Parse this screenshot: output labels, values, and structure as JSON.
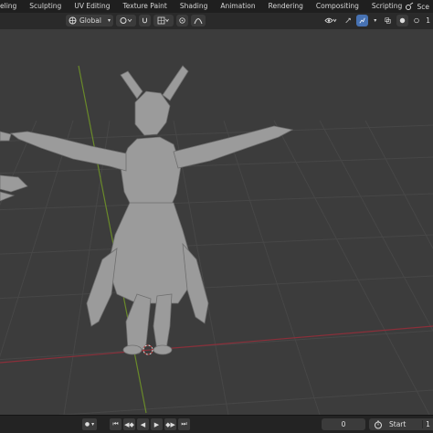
{
  "workspace_tabs": [
    "eling",
    "Sculpting",
    "UV Editing",
    "Texture Paint",
    "Shading",
    "Animation",
    "Rendering",
    "Compositing",
    "Scripting"
  ],
  "add_workspace": "+",
  "scene_label": "Sce",
  "viewport_header": {
    "orientation": "Global",
    "right_counter": "1"
  },
  "timeline": {
    "current_frame": "0",
    "start_label": "Start",
    "start_value": "1"
  },
  "colors": {
    "viewport_bg": "#3c3c3c",
    "grid": "#474747",
    "x_axis": "#8a2f3a",
    "y_axis": "#6a8a2a",
    "model": "#9b9b9b",
    "accent": "#4772b3"
  },
  "icons": {
    "orientation": "global-orientation-icon",
    "snap": "snap-magnet-icon",
    "proportional": "proportional-editing-icon",
    "gizmo": "gizmo-icon",
    "overlay": "overlay-icon",
    "xray": "xray-icon",
    "shading": "viewport-shading-icon",
    "play": "play-icon",
    "keyframe": "keyframe-icon",
    "timer": "stopwatch-icon"
  }
}
